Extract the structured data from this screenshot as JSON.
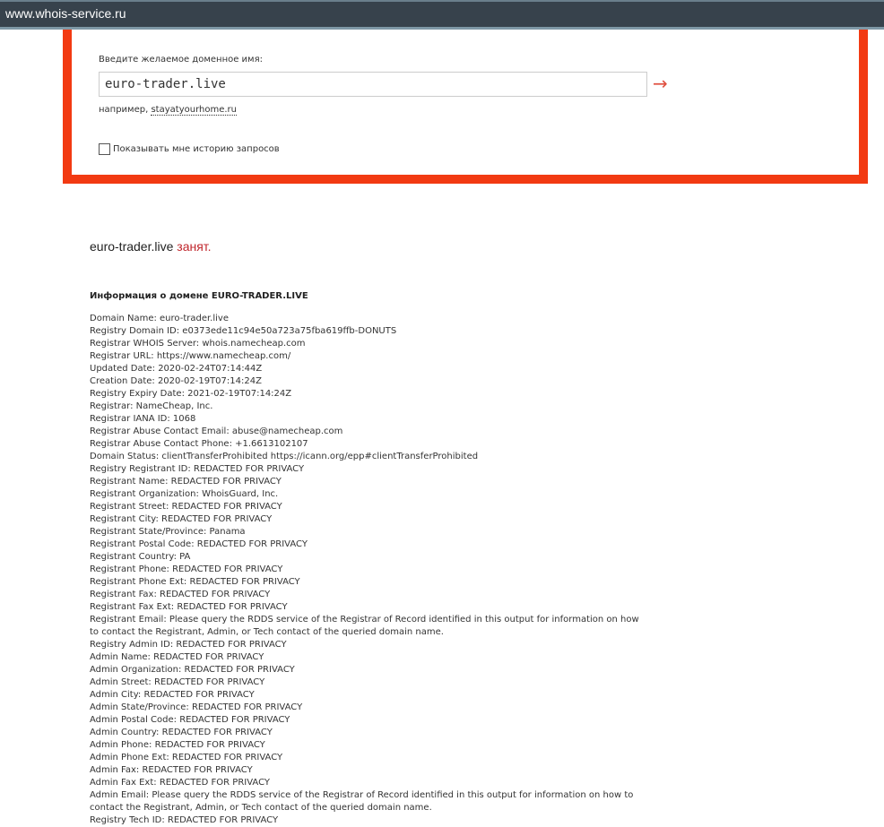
{
  "browser": {
    "url": "www.whois-service.ru"
  },
  "form": {
    "label": "Введите желаемое доменное имя:",
    "value": "euro-trader.live",
    "example_prefix": "например,",
    "example_link": "stayatyourhome.ru",
    "history_label": "Показывать мне историю запросов",
    "submit_icon": "arrow-right-icon"
  },
  "result": {
    "domain": "euro-trader.live",
    "status": "занят."
  },
  "info": {
    "heading": "Информация о домене EURO-TRADER.LIVE",
    "lines": [
      "Domain Name: euro-trader.live",
      "Registry Domain ID: e0373ede11c94e50a723a75fba619ffb-DONUTS",
      "Registrar WHOIS Server: whois.namecheap.com",
      "Registrar URL: https://www.namecheap.com/",
      "Updated Date: 2020-02-24T07:14:44Z",
      "Creation Date: 2020-02-19T07:14:24Z",
      "Registry Expiry Date: 2021-02-19T07:14:24Z",
      "Registrar: NameCheap, Inc.",
      "Registrar IANA ID: 1068",
      "Registrar Abuse Contact Email: abuse@namecheap.com",
      "Registrar Abuse Contact Phone: +1.6613102107",
      "Domain Status: clientTransferProhibited https://icann.org/epp#clientTransferProhibited",
      "Registry Registrant ID: REDACTED FOR PRIVACY",
      "Registrant Name: REDACTED FOR PRIVACY",
      "Registrant Organization: WhoisGuard, Inc.",
      "Registrant Street: REDACTED FOR PRIVACY",
      "Registrant City: REDACTED FOR PRIVACY",
      "Registrant State/Province: Panama",
      "Registrant Postal Code: REDACTED FOR PRIVACY",
      "Registrant Country: PA",
      "Registrant Phone: REDACTED FOR PRIVACY",
      "Registrant Phone Ext: REDACTED FOR PRIVACY",
      "Registrant Fax: REDACTED FOR PRIVACY",
      "Registrant Fax Ext: REDACTED FOR PRIVACY",
      "Registrant Email: Please query the RDDS service of the Registrar of Record identified in this output for information on how to contact the Registrant, Admin, or Tech contact of the queried domain name.",
      "Registry Admin ID: REDACTED FOR PRIVACY",
      "Admin Name: REDACTED FOR PRIVACY",
      "Admin Organization: REDACTED FOR PRIVACY",
      "Admin Street: REDACTED FOR PRIVACY",
      "Admin City: REDACTED FOR PRIVACY",
      "Admin State/Province: REDACTED FOR PRIVACY",
      "Admin Postal Code: REDACTED FOR PRIVACY",
      "Admin Country: REDACTED FOR PRIVACY",
      "Admin Phone: REDACTED FOR PRIVACY",
      "Admin Phone Ext: REDACTED FOR PRIVACY",
      "Admin Fax: REDACTED FOR PRIVACY",
      "Admin Fax Ext: REDACTED FOR PRIVACY",
      "Admin Email: Please query the RDDS service of the Registrar of Record identified in this output for information on how to contact the Registrant, Admin, or Tech contact of the queried domain name.",
      "Registry Tech ID: REDACTED FOR PRIVACY"
    ]
  }
}
